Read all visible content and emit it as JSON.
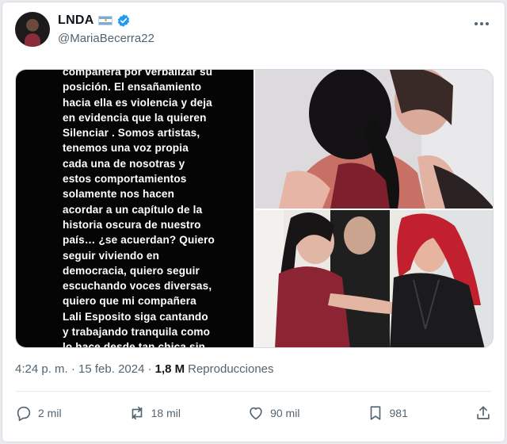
{
  "author": {
    "display_name": "LNDA",
    "handle": "@MariaBecerra22",
    "verified": true,
    "flag": "argentina-flag-icon",
    "avatar": "avatar"
  },
  "media": {
    "text_image_content": "compañera por verbalizar su\nposición. El ensañamiento\nhacia ella es violencia y deja\nen evidencia que la quieren\nSilenciar . Somos artistas,\ntenemos una voz propia\ncada una de nosotras y\nestos comportamientos\nsolamente nos hacen\nacordar a un capítulo de la\nhistoria oscura de nuestro\npaís… ¿se acuerdan? Quiero\nseguir viviendo en\ndemocracia, quiero seguir\nescuchando voces diversas,\nquiero que mi compañera\nLali Esposito siga cantando\ny trabajando tranquila como\nlo hace desde tan chica sin",
    "photos": [
      "hug-photo",
      "greeting-photo"
    ]
  },
  "meta": {
    "timestamp": "4:24 p. m. · 15 feb. 2024 ·",
    "views_count": "1,8 M",
    "views_label": "Reproducciones"
  },
  "actions": {
    "replies": "2 mil",
    "reposts": "18 mil",
    "likes": "90 mil",
    "bookmarks": "981"
  },
  "colors": {
    "verified_blue": "#1d9bf0",
    "secondary_text": "#536471",
    "primary_text": "#0f1419"
  }
}
